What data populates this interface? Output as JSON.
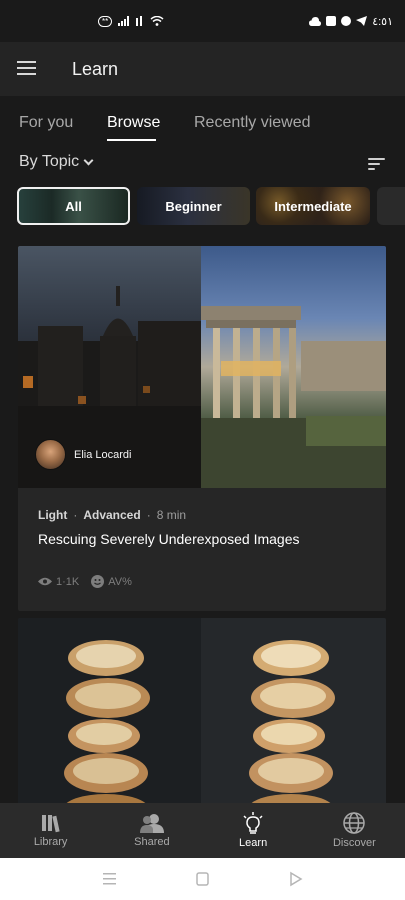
{
  "status_bar": {
    "time": "٤:٥١",
    "left_badge": "**"
  },
  "app_bar": {
    "title": "Learn"
  },
  "tabs": [
    {
      "label": "For you"
    },
    {
      "label": "Browse"
    },
    {
      "label": "Recently viewed"
    }
  ],
  "active_tab": "Browse",
  "filter": {
    "label": "By Topic"
  },
  "chips": [
    {
      "label": "All",
      "selected": true
    },
    {
      "label": "Beginner"
    },
    {
      "label": "Intermediate"
    }
  ],
  "cards": [
    {
      "author": "Elia Locardi",
      "topic": "Light",
      "level": "Advanced",
      "duration": "8 min",
      "title": "Rescuing Severely Underexposed Images",
      "views": "1·1K",
      "rating": "AV%"
    }
  ],
  "bottom_nav": [
    {
      "label": "Library",
      "icon": "library-icon"
    },
    {
      "label": "Shared",
      "icon": "shared-people-icon"
    },
    {
      "label": "Learn",
      "icon": "lightbulb-icon",
      "active": true
    },
    {
      "label": "Discover",
      "icon": "globe-icon"
    }
  ],
  "colors": {
    "background": "#1a1a1a",
    "app_bar": "#242424",
    "card": "#262626",
    "nav": "#2b2b2b"
  }
}
